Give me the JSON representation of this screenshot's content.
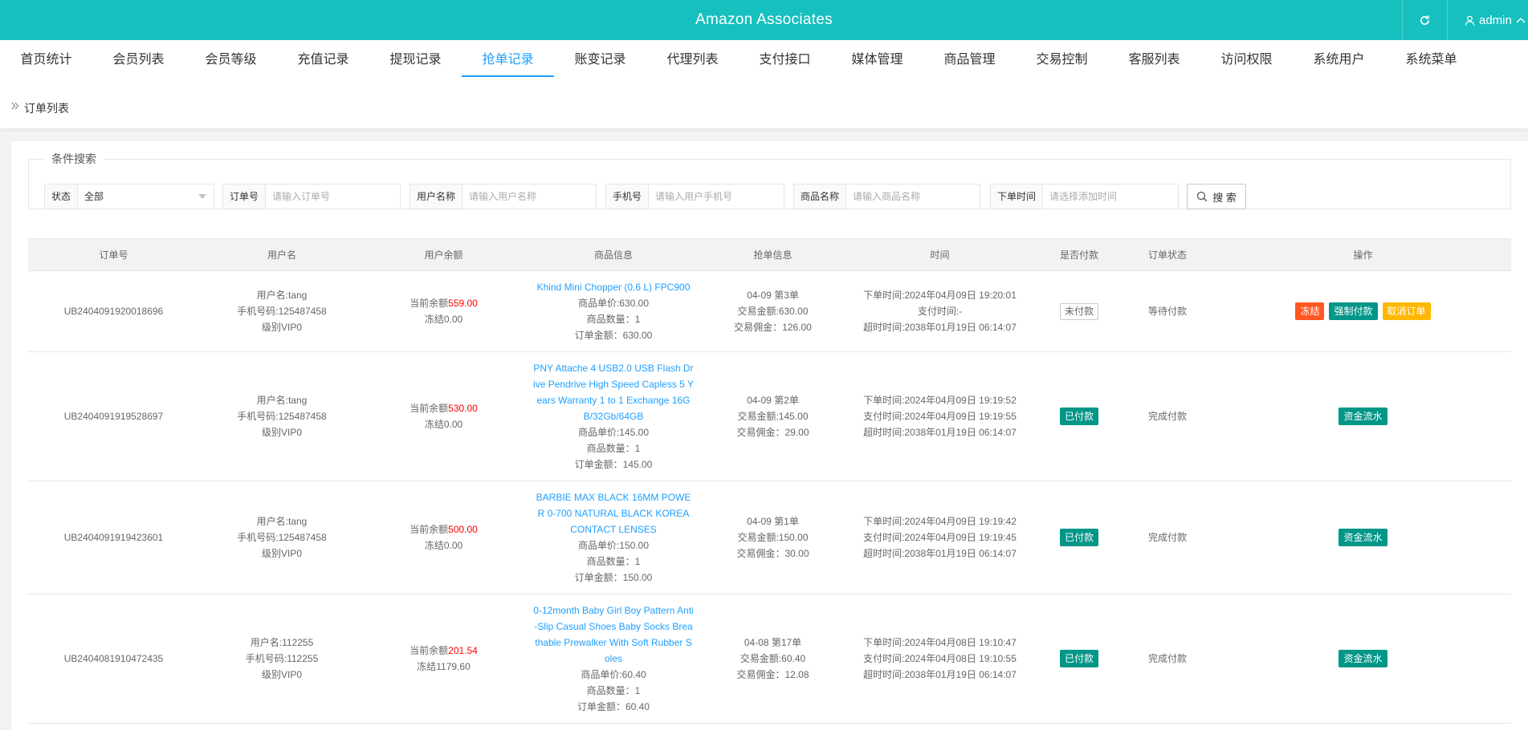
{
  "header": {
    "title": "Amazon Associates",
    "user": "admin",
    "icons": {
      "refresh": "refresh-icon",
      "user": "user-icon",
      "dropdown": "chevron-up-icon"
    }
  },
  "nav": {
    "tabs": [
      "首页统计",
      "会员列表",
      "会员等级",
      "充值记录",
      "提现记录",
      "抢单记录",
      "账变记录",
      "代理列表",
      "支付接口",
      "媒体管理",
      "商品管理",
      "交易控制",
      "客服列表",
      "访问权限",
      "系统用户",
      "系统菜单"
    ],
    "active_index": 5
  },
  "breadcrumb": {
    "text": "订单列表"
  },
  "search": {
    "legend": "条件搜索",
    "status": {
      "label": "状态",
      "value": "全部"
    },
    "order_no": {
      "label": "订单号",
      "placeholder": "请输入订单号"
    },
    "username": {
      "label": "用户名称",
      "placeholder": "请输入用户名称"
    },
    "phone": {
      "label": "手机号",
      "placeholder": "请输入用户手机号"
    },
    "product": {
      "label": "商品名称",
      "placeholder": "请输入商品名称"
    },
    "time": {
      "label": "下单时间",
      "placeholder": "请选择添加时间"
    },
    "button": "搜 索"
  },
  "table": {
    "headers": [
      "订单号",
      "用户名",
      "用户余额",
      "商品信息",
      "抢单信息",
      "时间",
      "是否付款",
      "订单状态",
      "操作"
    ],
    "rows": [
      {
        "order_no": "UB2404091920018696",
        "user_name": "用户名:tang",
        "user_phone": "手机号码:125487458",
        "user_level": "级别VIP0",
        "balance_label": "当前余额",
        "balance": "559.00",
        "frozen": "冻结0.00",
        "product_name": "Khind Mini Chopper (0.6 L) FPC900",
        "unit_price": "商品单价:630.00",
        "quantity": "商品数量：1",
        "order_amount": "订单金额：630.00",
        "grab_info": "04-09 第3单",
        "trade_amount": "交易金额:630.00",
        "commission": "交易佣金：126.00",
        "order_time": "下单时间:2024年04月09日 19:20:01",
        "pay_time": "支付时间:-",
        "expire_time": "超时时间:2038年01月19日 06:14:07",
        "paid": "未付款",
        "paid_state": "unpaid",
        "status": "等待付款",
        "actions": [
          "冻结",
          "强制付款",
          "取消订单"
        ]
      },
      {
        "order_no": "UB2404091919528697",
        "user_name": "用户名:tang",
        "user_phone": "手机号码:125487458",
        "user_level": "级别VIP0",
        "balance_label": "当前余额",
        "balance": "530.00",
        "frozen": "冻结0.00",
        "product_name": "PNY Attache 4 USB2.0 USB Flash Drive Pendrive High Speed Capless 5 Years Warranty 1 to 1 Exchange 16GB/32Gb/64GB",
        "unit_price": "商品单价:145.00",
        "quantity": "商品数量：1",
        "order_amount": "订单金额：145.00",
        "grab_info": "04-09 第2单",
        "trade_amount": "交易金额:145.00",
        "commission": "交易佣金：29.00",
        "order_time": "下单时间:2024年04月09日 19:19:52",
        "pay_time": "支付时间:2024年04月09日 19:19:55",
        "expire_time": "超时时间:2038年01月19日 06:14:07",
        "paid": "已付款",
        "paid_state": "paid",
        "status": "完成付款",
        "actions": [
          "资金流水"
        ]
      },
      {
        "order_no": "UB2404091919423601",
        "user_name": "用户名:tang",
        "user_phone": "手机号码:125487458",
        "user_level": "级别VIP0",
        "balance_label": "当前余额",
        "balance": "500.00",
        "frozen": "冻结0.00",
        "product_name": "BARBIE MAX BLACK 16MM POWER 0-700 NATURAL BLACK KOREA CONTACT LENSES",
        "unit_price": "商品单价:150.00",
        "quantity": "商品数量：1",
        "order_amount": "订单金额：150.00",
        "grab_info": "04-09 第1单",
        "trade_amount": "交易金额:150.00",
        "commission": "交易佣金：30.00",
        "order_time": "下单时间:2024年04月09日 19:19:42",
        "pay_time": "支付时间:2024年04月09日 19:19:45",
        "expire_time": "超时时间:2038年01月19日 06:14:07",
        "paid": "已付款",
        "paid_state": "paid",
        "status": "完成付款",
        "actions": [
          "资金流水"
        ]
      },
      {
        "order_no": "UB2404081910472435",
        "user_name": "用户名:112255",
        "user_phone": "手机号码:112255",
        "user_level": "级别VIP0",
        "balance_label": "当前余额",
        "balance": "201.54",
        "frozen": "冻结1179.60",
        "product_name": "0-12month Baby Girl Boy Pattern Anti-Slip Casual Shoes Baby Socks Breathable Prewalker With Soft Rubber Soles",
        "unit_price": "商品单价:60.40",
        "quantity": "商品数量：1",
        "order_amount": "订单金额：60.40",
        "grab_info": "04-08 第17单",
        "trade_amount": "交易金额:60.40",
        "commission": "交易佣金：12.08",
        "order_time": "下单时间:2024年04月08日 19:10:47",
        "pay_time": "支付时间:2024年04月08日 19:10:55",
        "expire_time": "超时时间:2038年01月19日 06:14:07",
        "paid": "已付款",
        "paid_state": "paid",
        "status": "完成付款",
        "actions": [
          "资金流水"
        ]
      }
    ]
  },
  "colors": {
    "header": "#16c0be",
    "link": "#1e9fff",
    "balance": "#ff0000",
    "paid": "#009688",
    "freeze": "#ff5722",
    "force_pay": "#009688",
    "cancel": "#ffb800"
  }
}
